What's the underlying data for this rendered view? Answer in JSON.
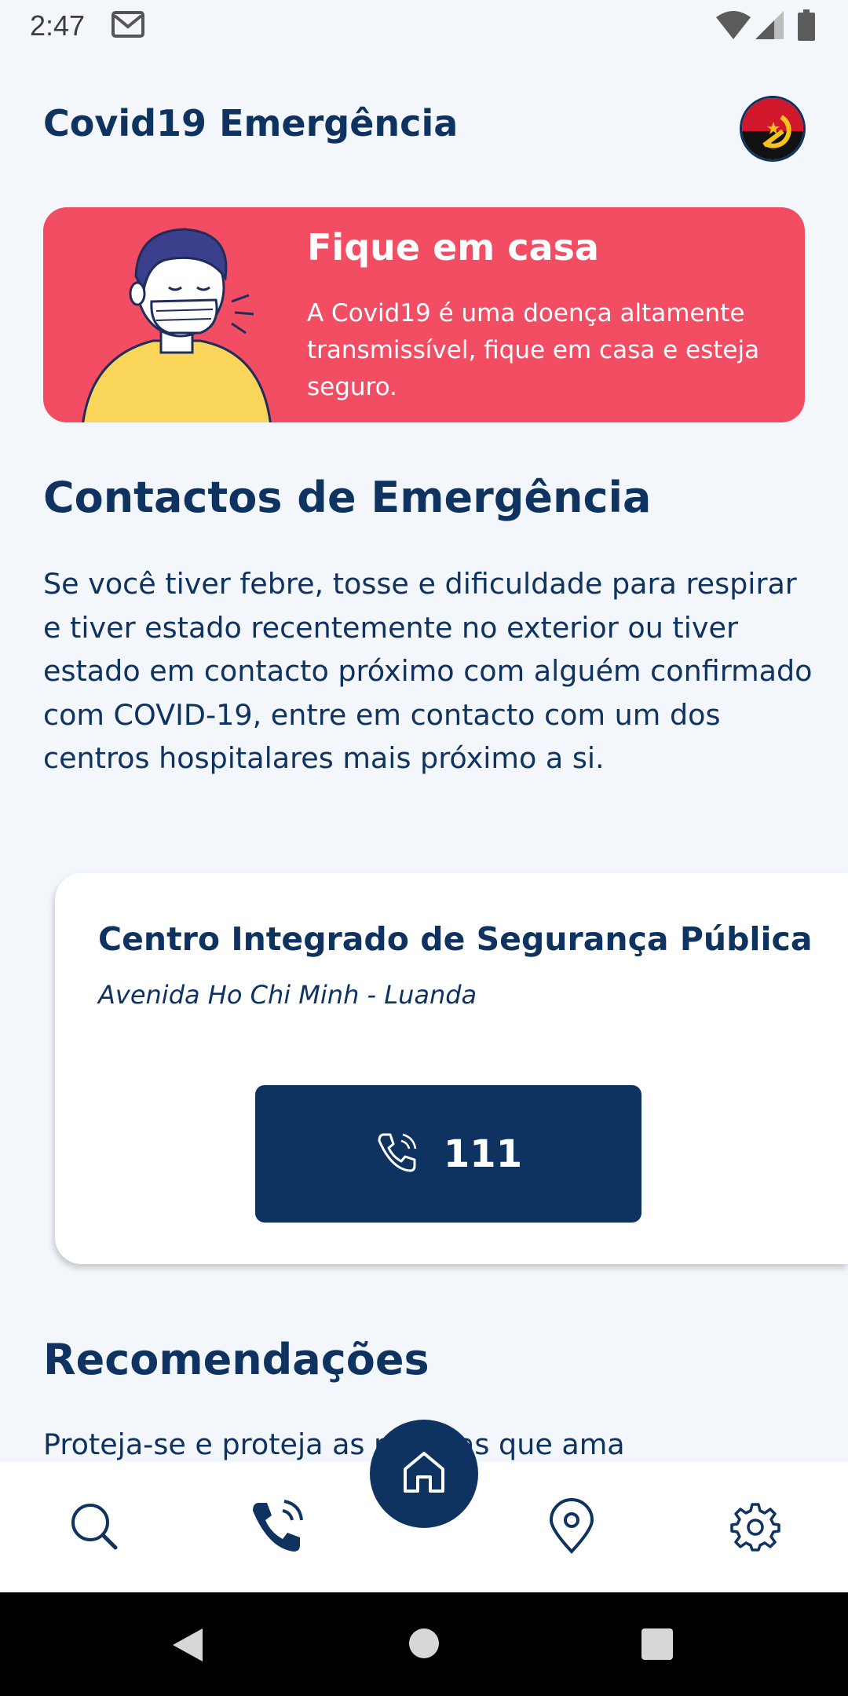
{
  "status_bar": {
    "time": "2:47",
    "icons": [
      "gmail-icon",
      "wifi-icon",
      "signal-icon",
      "battery-icon"
    ]
  },
  "header": {
    "title": "Covid19 Emergência",
    "flag_icon": "angola-flag-icon"
  },
  "banner": {
    "title": "Fique em casa",
    "text": "A Covid19 é uma doença altamente transmissível, fique em casa e esteja seguro.",
    "color": "#f24d63"
  },
  "contacts": {
    "title": "Contactos de Emergência",
    "description": "Se você tiver febre, tosse e dificuldade para respirar e tiver estado recentemente no exterior ou tiver estado em contacto próximo com alguém confirmado com COVID-19, entre em contacto com um dos centros hospitalares mais próximo a si.",
    "cards": [
      {
        "name": "Centro Integrado de Segurança Pública",
        "address": "Avenida Ho Chi Minh - Luanda",
        "phone": "111"
      }
    ]
  },
  "recommendations": {
    "title": "Recomendações",
    "text": "Proteja-se e proteja as pessoas que ama"
  },
  "bottom_nav": {
    "items": [
      "search-icon",
      "phone-icon",
      "home-icon",
      "location-pin-icon",
      "settings-icon"
    ],
    "accent": "#0f3360"
  }
}
